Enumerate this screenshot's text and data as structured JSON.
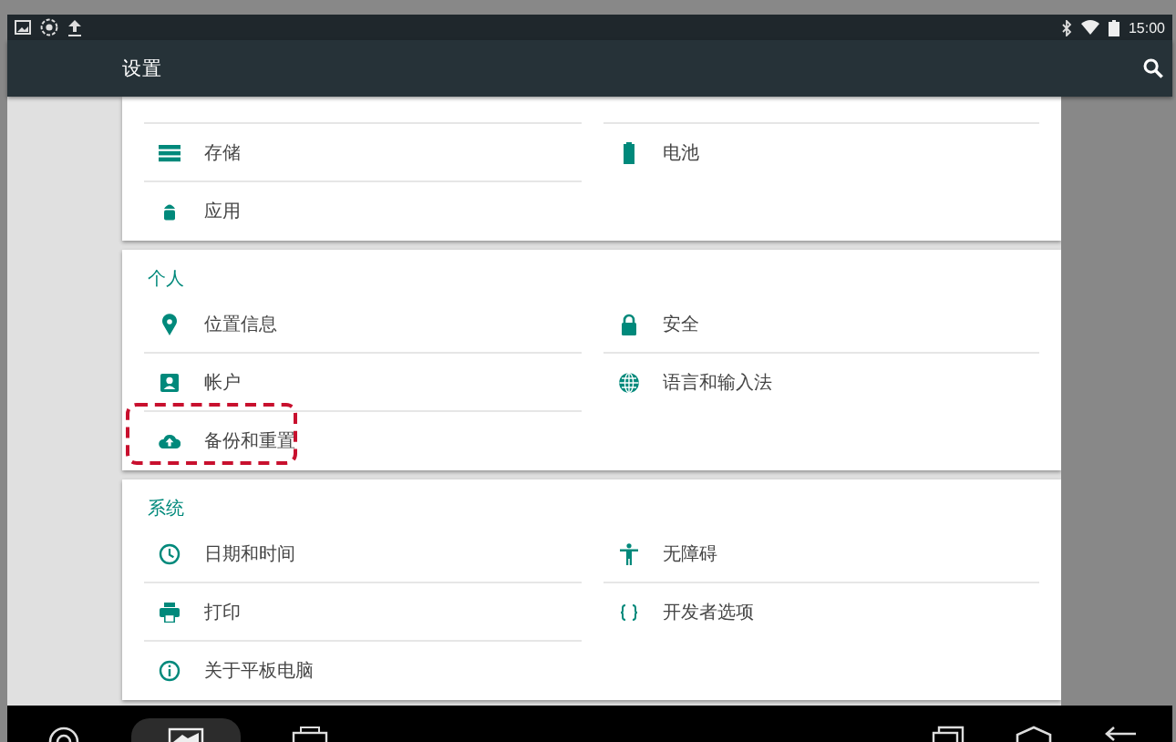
{
  "status_bar": {
    "time": "15:00"
  },
  "toolbar": {
    "title": "设置"
  },
  "sections": [
    {
      "items": [
        {
          "label": "存储",
          "highlighted": false
        },
        {
          "label": "电池",
          "highlighted": false
        },
        {
          "label": "应用",
          "highlighted": false
        }
      ]
    },
    {
      "header": "个人",
      "items": [
        {
          "label": "位置信息",
          "highlighted": false
        },
        {
          "label": "安全",
          "highlighted": false
        },
        {
          "label": "帐户",
          "highlighted": false
        },
        {
          "label": "语言和输入法",
          "highlighted": false
        },
        {
          "label": "备份和重置",
          "highlighted": true
        }
      ]
    },
    {
      "header": "系统",
      "items": [
        {
          "label": "日期和时间",
          "highlighted": false
        },
        {
          "label": "无障碍",
          "highlighted": false
        },
        {
          "label": "打印",
          "highlighted": false
        },
        {
          "label": "开发者选项",
          "highlighted": false
        },
        {
          "label": "关于平板电脑",
          "highlighted": false
        }
      ]
    }
  ]
}
